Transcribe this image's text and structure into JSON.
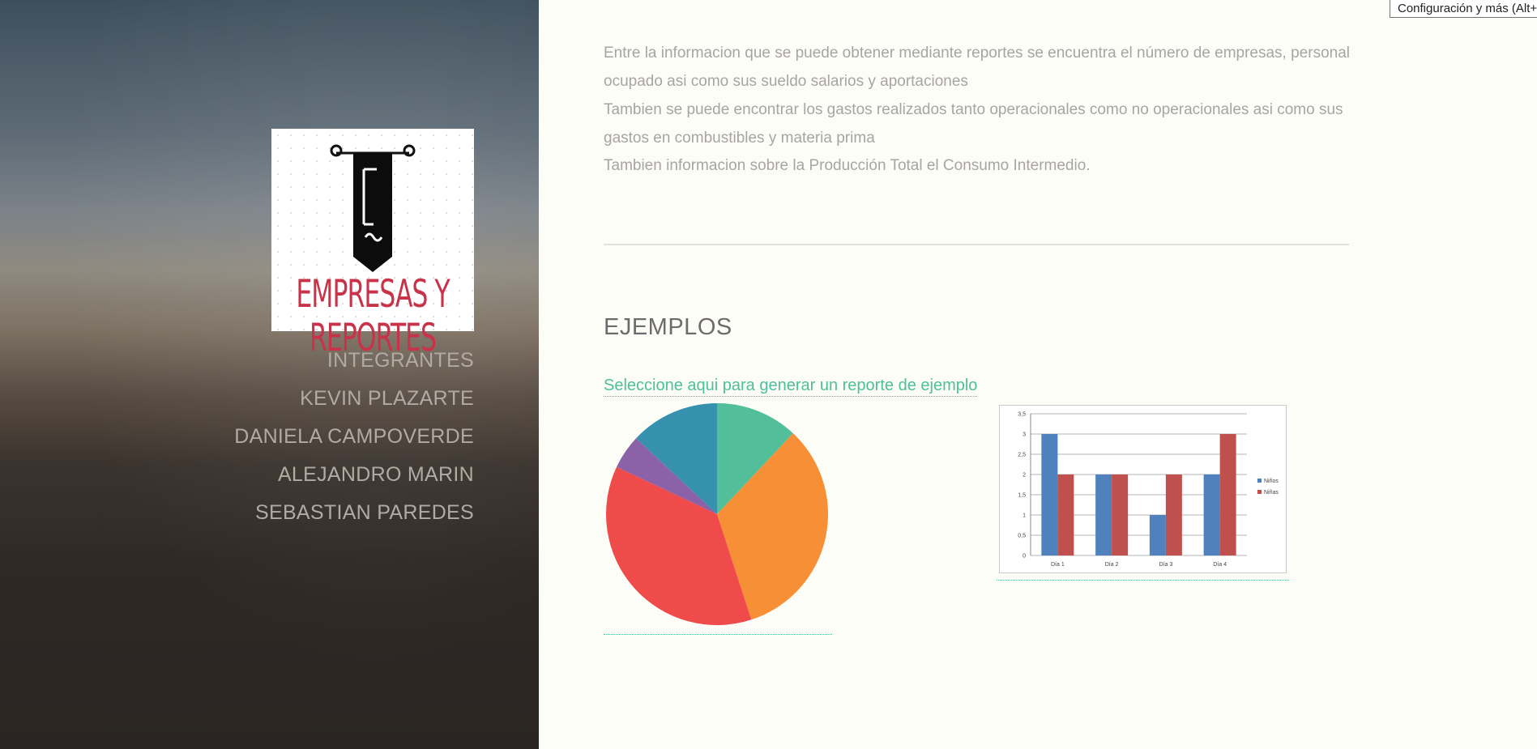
{
  "sidebar": {
    "logo_text": "EMPRESAS Y REPORTES",
    "nav_items": [
      "INTEGRANTES",
      "KEVIN PLAZARTE",
      "DANIELA CAMPOVERDE",
      "ALEJANDRO MARIN",
      "SEBASTIAN PAREDES"
    ]
  },
  "main": {
    "paragraphs": [
      "Entre la informacion que se puede obtener mediante reportes se encuentra el número de empresas, personal ocupado asi como sus sueldo salarios y aportaciones",
      "Tambien se puede encontrar los gastos realizados tanto operacionales como no operacionales asi como sus gastos en combustibles y materia prima",
      "Tambien informacion sobre la Producción Total el Consumo Intermedio."
    ],
    "heading": "EJEMPLOS",
    "report_link": "Seleccione aqui para generar un reporte de ejemplo"
  },
  "tooltip": "Configuración y más (Alt+F)",
  "colors": {
    "accent": "#4cbf9c",
    "logo_red": "#c8334a",
    "pie": [
      "#52bf9a",
      "#f68f35",
      "#ef4b4b",
      "#8b62a8",
      "#3691ae"
    ],
    "bar_ninos": "#4f81bd",
    "bar_ninas": "#c0504d"
  },
  "chart_data": [
    {
      "type": "pie",
      "slices": [
        {
          "value": 12,
          "color": "#52bf9a"
        },
        {
          "value": 33,
          "color": "#f68f35"
        },
        {
          "value": 37,
          "color": "#ef4b4b"
        },
        {
          "value": 5,
          "color": "#8b62a8"
        },
        {
          "value": 13,
          "color": "#3691ae"
        }
      ]
    },
    {
      "type": "bar",
      "categories": [
        "Día 1",
        "Día 2",
        "Día 3",
        "Día 4"
      ],
      "series": [
        {
          "name": "Niños",
          "values": [
            3,
            2,
            1,
            2
          ],
          "color": "#4f81bd"
        },
        {
          "name": "Niñas",
          "values": [
            2,
            2,
            2,
            3
          ],
          "color": "#c0504d"
        }
      ],
      "ylim": [
        0,
        3.5
      ],
      "yticks": [
        "0",
        "0,5",
        "1",
        "1,5",
        "2",
        "2,5",
        "3",
        "3,5"
      ],
      "grid": true,
      "legend": "right"
    }
  ]
}
